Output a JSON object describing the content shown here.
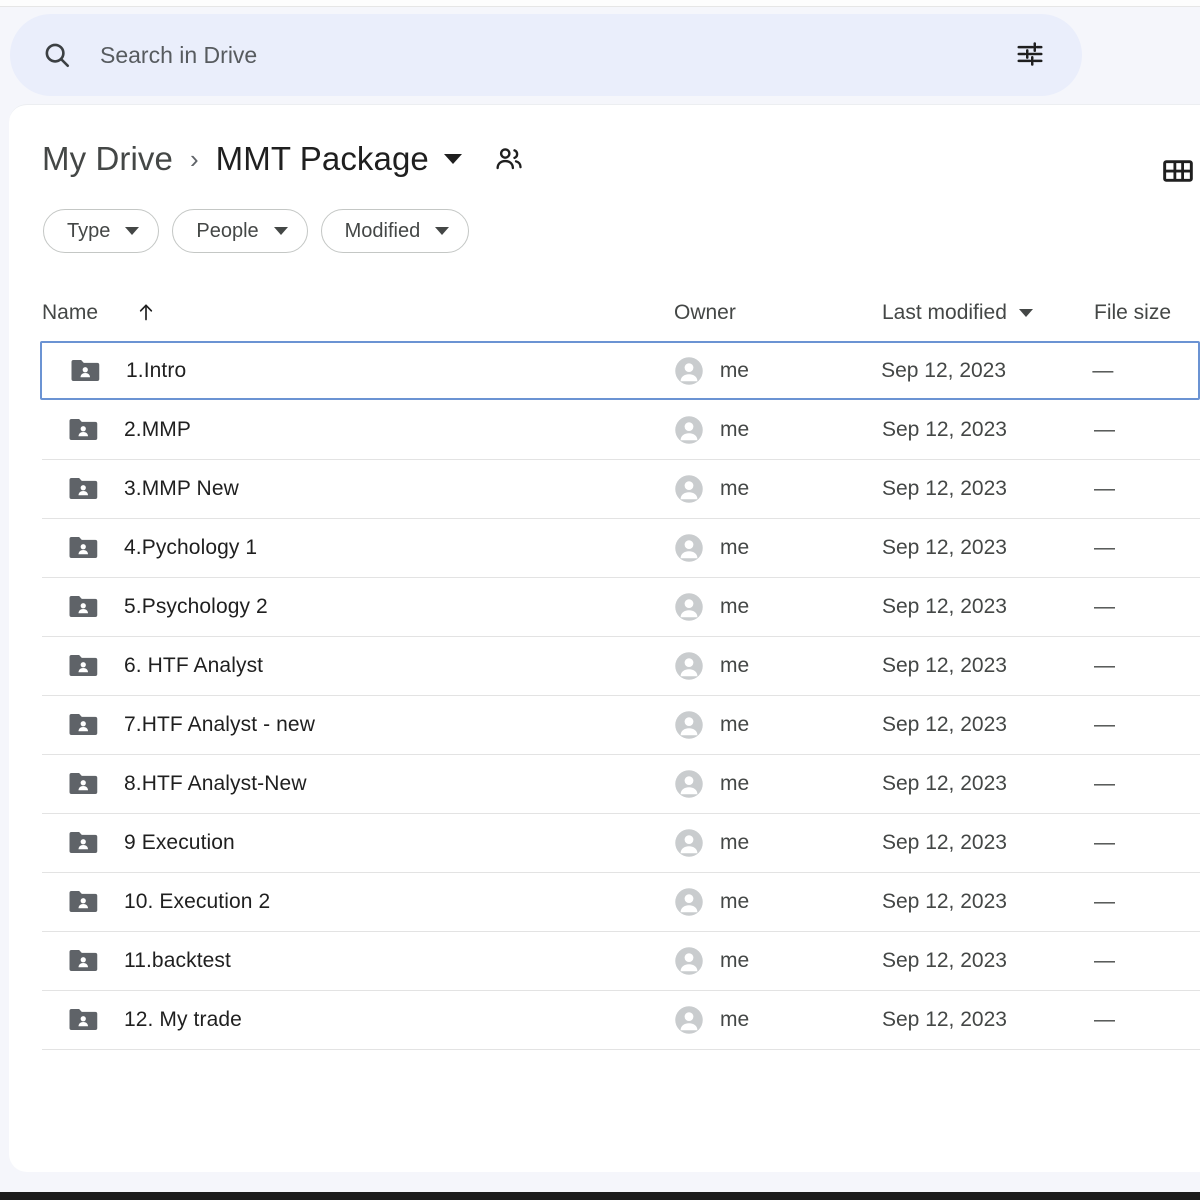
{
  "window": {
    "top_strip": "",
    "background_color": "#f5f6fb",
    "accent_color": "#6b93d3"
  },
  "search": {
    "placeholder": "Search in Drive",
    "value": "",
    "icon": "search-icon",
    "tune_icon": "tune-icon",
    "tune_label": "Search options"
  },
  "breadcrumb": {
    "root_label": "My Drive",
    "separator": "›",
    "current_label": "MMT Package",
    "caret_label": "Folder options",
    "share_icon": "people-icon",
    "grid_toggle_icon": "grid-view-icon"
  },
  "filters": [
    {
      "label": "Type",
      "name": "filter-chip-type"
    },
    {
      "label": "People",
      "name": "filter-chip-people"
    },
    {
      "label": "Modified",
      "name": "filter-chip-modified"
    }
  ],
  "table": {
    "columns": {
      "name": "Name",
      "owner": "Owner",
      "modified": "Last modified",
      "size": "File size"
    },
    "sort": {
      "column": "Name",
      "direction": "ascending",
      "arrow": "↑"
    },
    "rows": [
      {
        "name": "1.Intro",
        "owner": "me",
        "modified": "Sep 12, 2023",
        "size": "—",
        "selected": true,
        "icon": "shared-folder-icon"
      },
      {
        "name": "2.MMP",
        "owner": "me",
        "modified": "Sep 12, 2023",
        "size": "—",
        "selected": false,
        "icon": "shared-folder-icon"
      },
      {
        "name": "3.MMP New",
        "owner": "me",
        "modified": "Sep 12, 2023",
        "size": "—",
        "selected": false,
        "icon": "shared-folder-icon"
      },
      {
        "name": "4.Pychology 1",
        "owner": "me",
        "modified": "Sep 12, 2023",
        "size": "—",
        "selected": false,
        "icon": "shared-folder-icon"
      },
      {
        "name": "5.Psychology 2",
        "owner": "me",
        "modified": "Sep 12, 2023",
        "size": "—",
        "selected": false,
        "icon": "shared-folder-icon"
      },
      {
        "name": "6. HTF Analyst",
        "owner": "me",
        "modified": "Sep 12, 2023",
        "size": "—",
        "selected": false,
        "icon": "shared-folder-icon"
      },
      {
        "name": "7.HTF Analyst - new",
        "owner": "me",
        "modified": "Sep 12, 2023",
        "size": "—",
        "selected": false,
        "icon": "shared-folder-icon"
      },
      {
        "name": "8.HTF Analyst-New",
        "owner": "me",
        "modified": "Sep 12, 2023",
        "size": "—",
        "selected": false,
        "icon": "shared-folder-icon"
      },
      {
        "name": "9 Execution",
        "owner": "me",
        "modified": "Sep 12, 2023",
        "size": "—",
        "selected": false,
        "icon": "shared-folder-icon"
      },
      {
        "name": "10. Execution 2",
        "owner": "me",
        "modified": "Sep 12, 2023",
        "size": "—",
        "selected": false,
        "icon": "shared-folder-icon"
      },
      {
        "name": "11.backtest",
        "owner": "me",
        "modified": "Sep 12, 2023",
        "size": "—",
        "selected": false,
        "icon": "shared-folder-icon"
      },
      {
        "name": "12. My trade",
        "owner": "me",
        "modified": "Sep 12, 2023",
        "size": "—",
        "selected": false,
        "icon": "shared-folder-icon"
      }
    ]
  }
}
